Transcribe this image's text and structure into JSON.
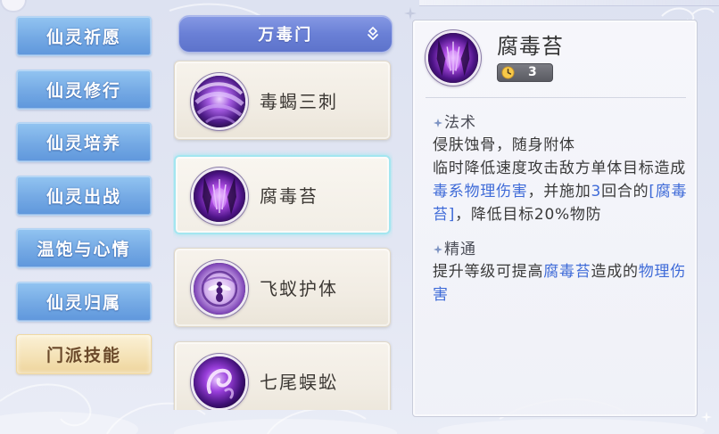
{
  "menu": {
    "selected_index": 6,
    "items": [
      {
        "label": "仙灵祈愿"
      },
      {
        "label": "仙灵修行"
      },
      {
        "label": "仙灵培养"
      },
      {
        "label": "仙灵出战"
      },
      {
        "label": "温饱与心情"
      },
      {
        "label": "仙灵归属"
      },
      {
        "label": "门派技能"
      }
    ]
  },
  "school_select": {
    "value": "万毒门",
    "icon": "chevron-down-icon"
  },
  "skills": {
    "selected_index": 1,
    "items": [
      {
        "name": "毒蝎三刺",
        "icon": "scorpion-strike-skill-icon"
      },
      {
        "name": "腐毒苔",
        "icon": "poison-moss-skill-icon"
      },
      {
        "name": "飞蚁护体",
        "icon": "flying-ant-skill-icon"
      },
      {
        "name": "七尾蜈蚣",
        "icon": "seven-tail-centipede-skill-icon"
      }
    ]
  },
  "detail": {
    "name": "腐毒苔",
    "icon": "poison-moss-skill-icon",
    "cooldown": {
      "icon": "clock-icon",
      "value": "3"
    },
    "sections": [
      {
        "title": "法术",
        "bullet_icon": "sparkle-bullet-icon",
        "lines": [
          [
            {
              "text": "侵肤蚀骨，随身附体"
            }
          ],
          [
            {
              "text": "临时降低速度攻击敌方单体目标造成"
            }
          ],
          [
            {
              "text": "毒系物理伤害",
              "highlight": true
            },
            {
              "text": "，并施加"
            },
            {
              "text": "3",
              "highlight": true
            },
            {
              "text": "回合的"
            },
            {
              "text": "[腐毒",
              "highlight": true
            }
          ],
          [
            {
              "text": "苔]",
              "highlight": true
            },
            {
              "text": "，降低目标20%物防"
            }
          ]
        ]
      },
      {
        "title": "精通",
        "bullet_icon": "sparkle-bullet-icon",
        "lines": [
          [
            {
              "text": "提升等级可提高"
            },
            {
              "text": "腐毒苔",
              "highlight": true
            },
            {
              "text": "造成的"
            },
            {
              "text": "物理伤",
              "highlight": true
            }
          ],
          [
            {
              "text": "害",
              "highlight": true
            }
          ]
        ]
      }
    ]
  },
  "colors": {
    "menu_button": "#74a9e4",
    "menu_button_selected": "#f4e1b4",
    "menu_text_selected": "#6b4a2b",
    "dropdown": "#6a80d6",
    "card": "#f1ece3",
    "card_selected_border": "#a3e6f0",
    "text": "#3a3a3a",
    "highlight": "#3f6bd8"
  }
}
